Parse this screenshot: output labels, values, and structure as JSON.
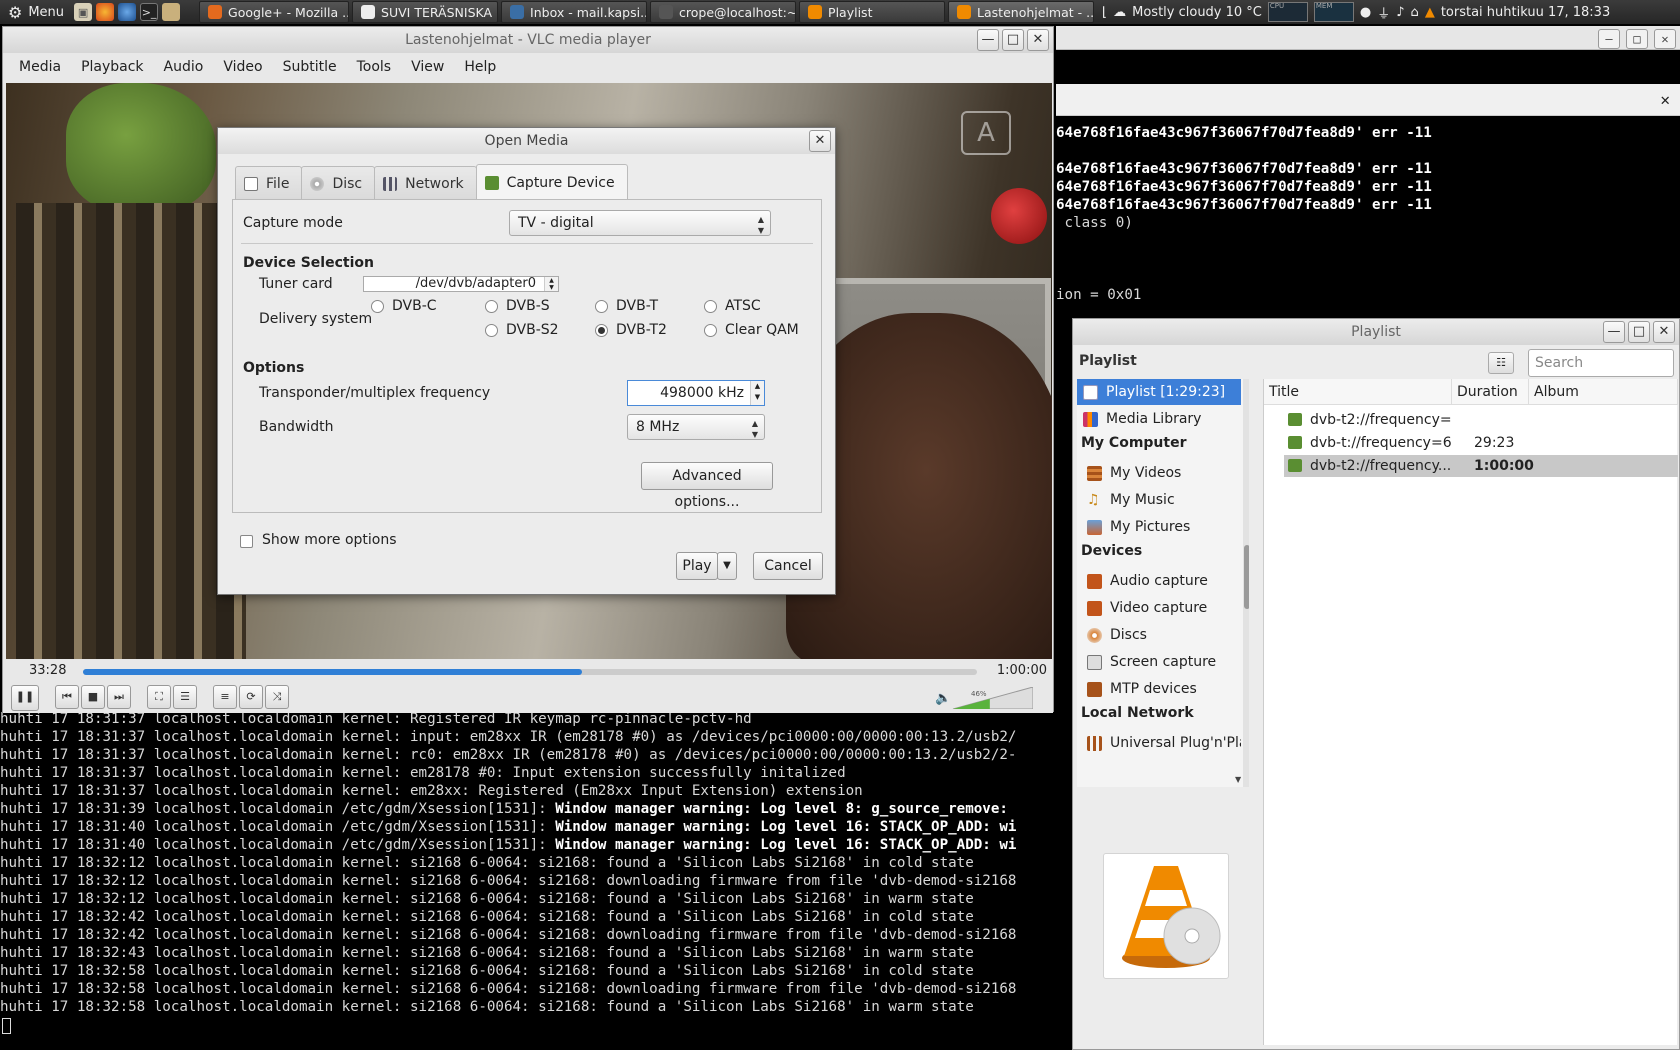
{
  "panel": {
    "menu_label": "Menu",
    "tasks": [
      {
        "label": "Google+ - Mozilla ...",
        "color": "#e46a1e"
      },
      {
        "label": "SUVI TERÄSNISKA ...",
        "color": "#f0f0f0"
      },
      {
        "label": "Inbox - mail.kapsi....",
        "color": "#3a6ea5"
      },
      {
        "label": "crope@localhost:~",
        "color": "#777777"
      },
      {
        "label": "Playlist",
        "color": "#f08a00"
      },
      {
        "label": "Lastenohjelmat - ...",
        "color": "#f08a00"
      }
    ],
    "weather": "Mostly cloudy 10 °C",
    "graph_labels": [
      "CPU",
      "MEM"
    ],
    "clock": "torstai huhtikuu 17, 18:33"
  },
  "vlc": {
    "title": "Lastenohjelmat - VLC media player",
    "menu": [
      "Media",
      "Playback",
      "Audio",
      "Video",
      "Subtitle",
      "Tools",
      "View",
      "Help"
    ],
    "time_elapsed": "33:28",
    "time_total": "1:00:00",
    "progress": 0.558,
    "volume_label": "46%"
  },
  "dialog": {
    "title": "Open Media",
    "tabs": [
      "File",
      "Disc",
      "Network",
      "Capture Device"
    ],
    "capture_mode_label": "Capture mode",
    "capture_mode_value": "TV - digital",
    "device_selection": "Device Selection",
    "tuner_label": "Tuner card",
    "tuner_value": "/dev/dvb/adapter0",
    "delivery_label": "Delivery system",
    "delivery_options": [
      "DVB-C",
      "DVB-S",
      "DVB-T",
      "ATSC",
      "DVB-S2",
      "DVB-T2",
      "Clear QAM"
    ],
    "delivery_selected": "DVB-T2",
    "options_heading": "Options",
    "freq_label": "Transponder/multiplex frequency",
    "freq_value": "498000 kHz",
    "bandwidth_label": "Bandwidth",
    "bandwidth_value": "8 MHz",
    "advanced_btn": "Advanced options...",
    "show_more": "Show more options",
    "play_btn": "Play",
    "cancel_btn": "Cancel"
  },
  "playlist": {
    "title": "Playlist",
    "heading": "Playlist",
    "search_placeholder": "Search",
    "sidebar": {
      "playlist_item": "Playlist [1:29:23]",
      "media_library": "Media Library",
      "my_computer": "My Computer",
      "my_videos": "My Videos",
      "my_music": "My Music",
      "my_pictures": "My Pictures",
      "devices": "Devices",
      "audio_capture": "Audio capture",
      "video_capture": "Video capture",
      "discs": "Discs",
      "screen_capture": "Screen capture",
      "mtp_devices": "MTP devices",
      "local_network": "Local Network",
      "upnp": "Universal Plug'n'Play"
    },
    "columns": [
      "Title",
      "Duration",
      "Album"
    ],
    "rows": [
      {
        "title": "dvb-t2://frequency=...",
        "duration": ""
      },
      {
        "title": "dvb-t://frequency=6...",
        "duration": "29:23"
      },
      {
        "title": "dvb-t2://frequency...",
        "duration": "1:00:00"
      }
    ]
  },
  "terminal": {
    "right_lines": [
      "64e768f16fae43c967f36067f70d7fea8d9' err -11",
      "",
      "64e768f16fae43c967f36067f70d7fea8d9' err -11",
      "64e768f16fae43c967f36067f70d7fea8d9' err -11",
      "64e768f16fae43c967f36067f70d7fea8d9' err -11",
      " class 0)",
      "",
      "",
      "",
      "ion = 0x01"
    ],
    "bottom_lines": [
      {
        "plain": "huhti 17 18:31:37 localhost.localdomain kernel: Registered IR keymap rc-pinnacle-pctv-hd",
        "bold": ""
      },
      {
        "plain": "huhti 17 18:31:37 localhost.localdomain kernel: input: em28xx IR (em28178 #0) as /devices/pci0000:00/0000:00:13.2/usb2/",
        "bold": ""
      },
      {
        "plain": "huhti 17 18:31:37 localhost.localdomain kernel: rc0: em28xx IR (em28178 #0) as /devices/pci0000:00/0000:00:13.2/usb2/2-",
        "bold": ""
      },
      {
        "plain": "huhti 17 18:31:37 localhost.localdomain kernel: em28178 #0: Input extension successfully initalized",
        "bold": ""
      },
      {
        "plain": "huhti 17 18:31:37 localhost.localdomain kernel: em28xx: Registered (Em28xx Input Extension) extension",
        "bold": ""
      },
      {
        "plain": "huhti 17 18:31:39 localhost.localdomain /etc/gdm/Xsession[1531]: ",
        "bold": "Window manager warning: Log level 8: g_source_remove: "
      },
      {
        "plain": "huhti 17 18:31:40 localhost.localdomain /etc/gdm/Xsession[1531]: ",
        "bold": "Window manager warning: Log level 16: STACK_OP_ADD: wi"
      },
      {
        "plain": "huhti 17 18:31:40 localhost.localdomain /etc/gdm/Xsession[1531]: ",
        "bold": "Window manager warning: Log level 16: STACK_OP_ADD: wi"
      },
      {
        "plain": "huhti 17 18:32:12 localhost.localdomain kernel: si2168 6-0064: si2168: found a 'Silicon Labs Si2168' in cold state",
        "bold": ""
      },
      {
        "plain": "huhti 17 18:32:12 localhost.localdomain kernel: si2168 6-0064: si2168: downloading firmware from file 'dvb-demod-si2168",
        "bold": ""
      },
      {
        "plain": "huhti 17 18:32:12 localhost.localdomain kernel: si2168 6-0064: si2168: found a 'Silicon Labs Si2168' in warm state",
        "bold": ""
      },
      {
        "plain": "huhti 17 18:32:42 localhost.localdomain kernel: si2168 6-0064: si2168: found a 'Silicon Labs Si2168' in cold state",
        "bold": ""
      },
      {
        "plain": "huhti 17 18:32:42 localhost.localdomain kernel: si2168 6-0064: si2168: downloading firmware from file 'dvb-demod-si2168",
        "bold": ""
      },
      {
        "plain": "huhti 17 18:32:43 localhost.localdomain kernel: si2168 6-0064: si2168: found a 'Silicon Labs Si2168' in warm state",
        "bold": ""
      },
      {
        "plain": "huhti 17 18:32:58 localhost.localdomain kernel: si2168 6-0064: si2168: found a 'Silicon Labs Si2168' in cold state",
        "bold": ""
      },
      {
        "plain": "huhti 17 18:32:58 localhost.localdomain kernel: si2168 6-0064: si2168: downloading firmware from file 'dvb-demod-si2168",
        "bold": ""
      },
      {
        "plain": "huhti 17 18:32:58 localhost.localdomain kernel: si2168 6-0064: si2168: found a 'Silicon Labs Si2168' in warm state",
        "bold": ""
      }
    ]
  }
}
